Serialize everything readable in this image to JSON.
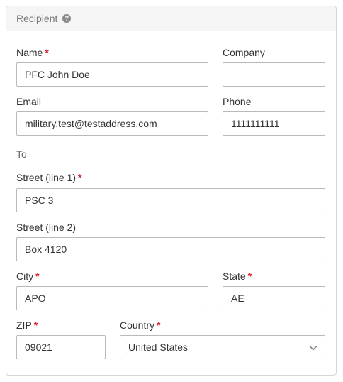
{
  "panel": {
    "title": "Recipient",
    "help_icon": "question-circle-icon"
  },
  "fields": {
    "name": {
      "label": "Name",
      "required": "*",
      "value": "PFC John Doe"
    },
    "company": {
      "label": "Company",
      "value": ""
    },
    "email": {
      "label": "Email",
      "value": "military.test@testaddress.com"
    },
    "phone": {
      "label": "Phone",
      "value": "1111111111"
    },
    "to_label": "To",
    "street1": {
      "label": "Street (line 1)",
      "required": "*",
      "value": "PSC 3"
    },
    "street2": {
      "label": "Street (line 2)",
      "value": "Box 4120"
    },
    "city": {
      "label": "City",
      "required": "*",
      "value": "APO"
    },
    "state": {
      "label": "State",
      "required": "*",
      "value": "AE"
    },
    "zip": {
      "label": "ZIP",
      "required": "*",
      "value": "09021"
    },
    "country": {
      "label": "Country",
      "required": "*",
      "value": "United States",
      "chevron_icon": "chevron-down-icon"
    }
  },
  "colors": {
    "required": "#d9232e",
    "border": "#b9b9b9",
    "header_bg": "#f5f5f5"
  }
}
